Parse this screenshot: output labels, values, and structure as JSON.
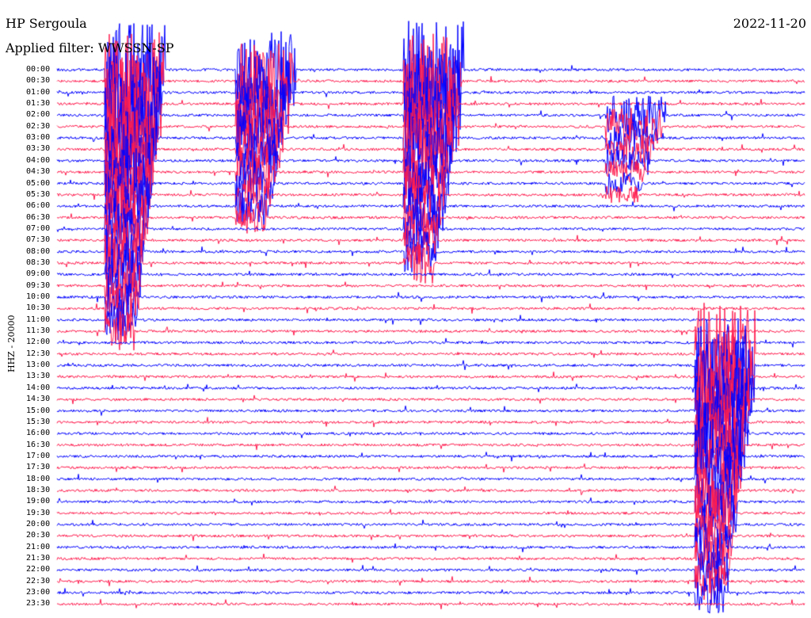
{
  "header": {
    "station": "HP Sergoula",
    "filter": "Applied filter: WWSSN-SP",
    "date": "2022-11-20"
  },
  "chart_data": {
    "type": "helicorder",
    "channel_label": "HHZ - 20000",
    "title": "HP Sergoula",
    "date": "2022-11-20",
    "filter": "WWSSN-SP",
    "trace_colors": [
      "#0000ff",
      "#ff1a4d"
    ],
    "row_labels": [
      "00:00",
      "00:30",
      "01:00",
      "01:30",
      "02:00",
      "02:30",
      "03:00",
      "03:30",
      "04:00",
      "04:30",
      "05:00",
      "05:30",
      "06:00",
      "06:30",
      "07:00",
      "07:30",
      "08:00",
      "08:30",
      "09:00",
      "09:30",
      "10:00",
      "10:30",
      "11:00",
      "11:30",
      "12:00",
      "12:30",
      "13:00",
      "13:30",
      "14:00",
      "14:30",
      "15:00",
      "15:30",
      "16:00",
      "16:30",
      "17:00",
      "17:30",
      "18:00",
      "18:30",
      "19:00",
      "19:30",
      "20:00",
      "20:30",
      "21:00",
      "21:30",
      "22:00",
      "22:30",
      "23:00",
      "23:30"
    ],
    "events": [
      {
        "row": 0,
        "x_frac": 0.07,
        "amplitude": 10,
        "duration_rows": 24,
        "color_of_row": true
      },
      {
        "row": 0,
        "x_frac": 0.245,
        "amplitude": 8,
        "duration_rows": 14
      },
      {
        "row": 0,
        "x_frac": 0.47,
        "amplitude": 10,
        "duration_rows": 18
      },
      {
        "row": 4,
        "x_frac": 0.74,
        "amplitude": 4,
        "duration_rows": 8
      },
      {
        "row": 25,
        "x_frac": 0.86,
        "amplitude": 10,
        "duration_rows": 22
      }
    ]
  }
}
